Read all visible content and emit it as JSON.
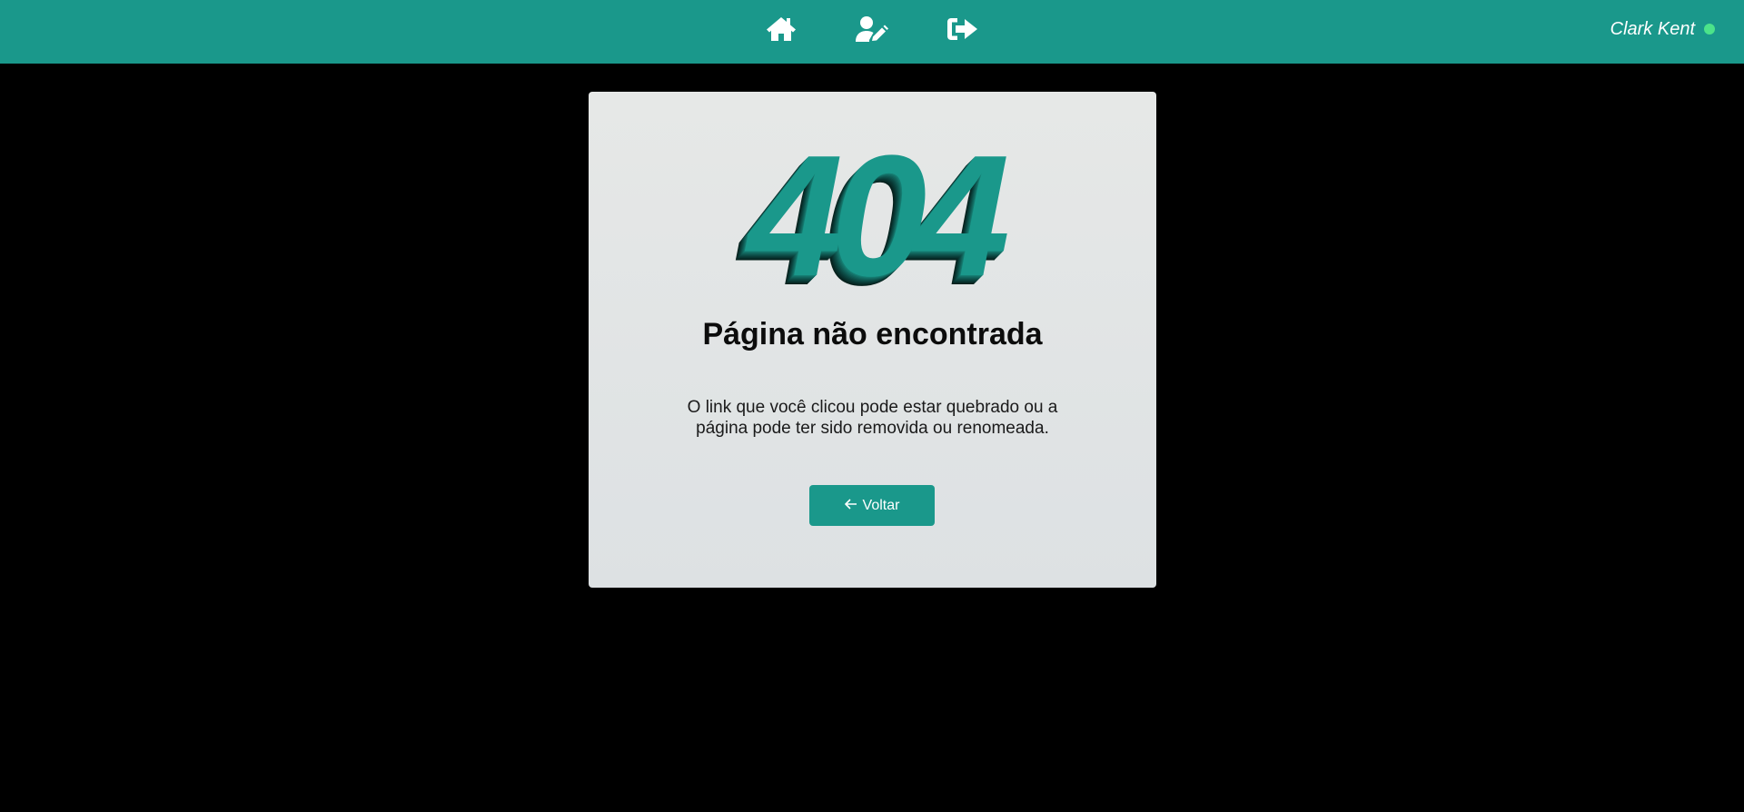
{
  "header": {
    "icons": [
      "home-icon",
      "user-edit-icon",
      "logout-icon"
    ],
    "user_name": "Clark Kent",
    "status_color": "#4ce38a"
  },
  "error": {
    "code": "404",
    "title": "Página não encontrada",
    "message_line1": "O link que você clicou pode estar quebrado ou a",
    "message_line2": "página pode ter sido removida ou renomeada.",
    "back_label": "Voltar",
    "back_icon": "arrow-left-icon"
  },
  "colors": {
    "accent": "#1a988b",
    "background": "#000000",
    "card": "#e2e5e5"
  }
}
